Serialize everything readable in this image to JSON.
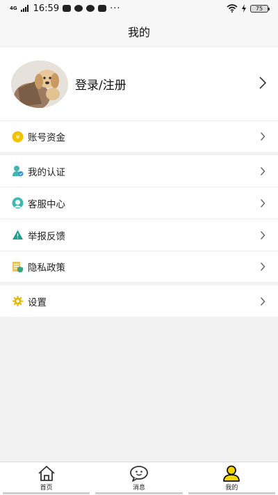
{
  "status_bar": {
    "network": "4G",
    "time": "16:59",
    "more": "···",
    "battery": "75"
  },
  "header": {
    "title": "我的"
  },
  "profile": {
    "login_label": "登录/注册"
  },
  "menu": {
    "account_funds": "账号资金",
    "my_verification": "我的认证",
    "customer_service": "客服中心",
    "report_feedback": "举报反馈",
    "privacy_policy": "隐私政策",
    "settings": "设置"
  },
  "tabs": [
    {
      "label": "首页",
      "icon": "home-icon"
    },
    {
      "label": "消息",
      "icon": "message-icon"
    },
    {
      "label": "我的",
      "icon": "user-icon",
      "active": true
    }
  ],
  "colors": {
    "accent_yellow": "#f5d400",
    "coin": "#f2c200",
    "teal": "#3fb7b0",
    "verify_blue": "#2e8fd8"
  }
}
